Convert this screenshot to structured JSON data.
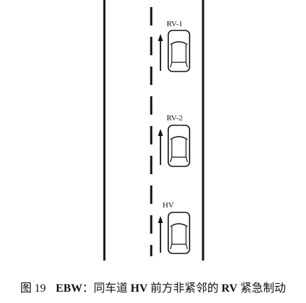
{
  "vehicles": [
    {
      "label": "RV-1"
    },
    {
      "label": "RV-2"
    },
    {
      "label": "HV"
    }
  ],
  "caption": {
    "figure_label": "图 19",
    "parts": [
      "EBW",
      "：同车道 ",
      "HV",
      " 前方非紧邻的 ",
      "RV",
      " 紧急制动"
    ]
  },
  "colors": {
    "line": "#111111",
    "background": "#ffffff"
  }
}
